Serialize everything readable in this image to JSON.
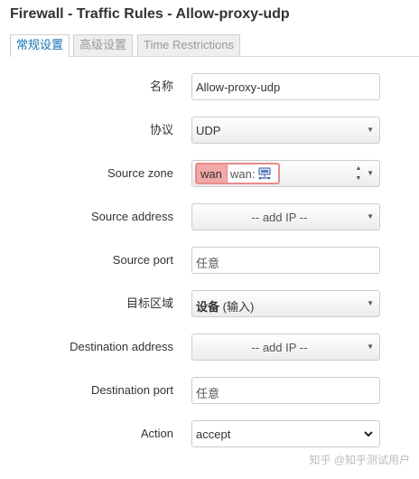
{
  "page": {
    "title": "Firewall - Traffic Rules - Allow-proxy-udp"
  },
  "tabs": [
    {
      "label": "常规设置",
      "active": true
    },
    {
      "label": "高级设置",
      "active": false
    },
    {
      "label": "Time Restrictions",
      "active": false
    }
  ],
  "form": {
    "name": {
      "label": "名称",
      "value": "Allow-proxy-udp"
    },
    "protocol": {
      "label": "协议",
      "value": "UDP"
    },
    "source_zone": {
      "label": "Source zone",
      "zone": "wan",
      "network_label": "wan:",
      "icon": "network-icon"
    },
    "source_address": {
      "label": "Source address",
      "value": "-- add IP --"
    },
    "source_port": {
      "label": "Source port",
      "placeholder": "任意"
    },
    "dest_zone": {
      "label": "目标区域",
      "value": "设备",
      "suffix": "(输入)"
    },
    "dest_address": {
      "label": "Destination address",
      "value": "-- add IP --"
    },
    "dest_port": {
      "label": "Destination port",
      "placeholder": "任意"
    },
    "action": {
      "label": "Action",
      "value": "accept"
    }
  },
  "watermark": "知乎 @知乎测试用户",
  "colors": {
    "accent": "#1a73b5",
    "zone_wan": "#f2a8a8"
  }
}
